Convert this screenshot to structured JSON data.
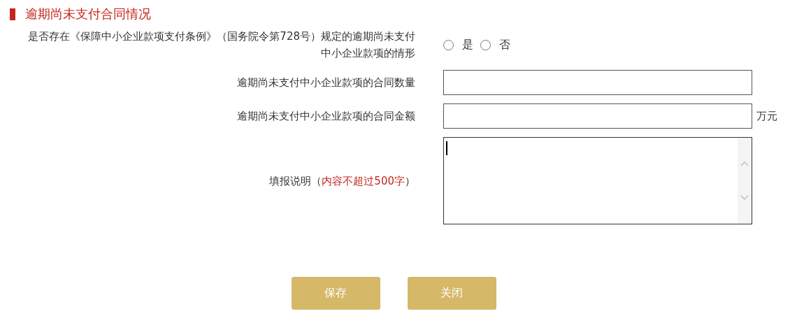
{
  "section_title": "逾期尚未支付合同情况",
  "question": {
    "label": "是否存在《保障中小企业款项支付条例》（国务院令第728号）规定的逾期尚未支付中小企业款项的情形",
    "options": [
      {
        "label": "是",
        "selected": false
      },
      {
        "label": "否",
        "selected": false
      }
    ]
  },
  "fields": [
    {
      "label": "逾期尚未支付中小企业款项的合同数量"
    },
    {
      "label": "逾期尚未支付中小企业款项的合同金额",
      "unit": "万元"
    }
  ],
  "note": {
    "label_parts": [
      {
        "text": "填报说明（",
        "kind": "plain"
      },
      {
        "text": "内容不超过500字",
        "kind": "hint"
      },
      {
        "text": "）",
        "kind": "plain"
      }
    ]
  },
  "buttons": [
    "保存",
    "关闭"
  ]
}
